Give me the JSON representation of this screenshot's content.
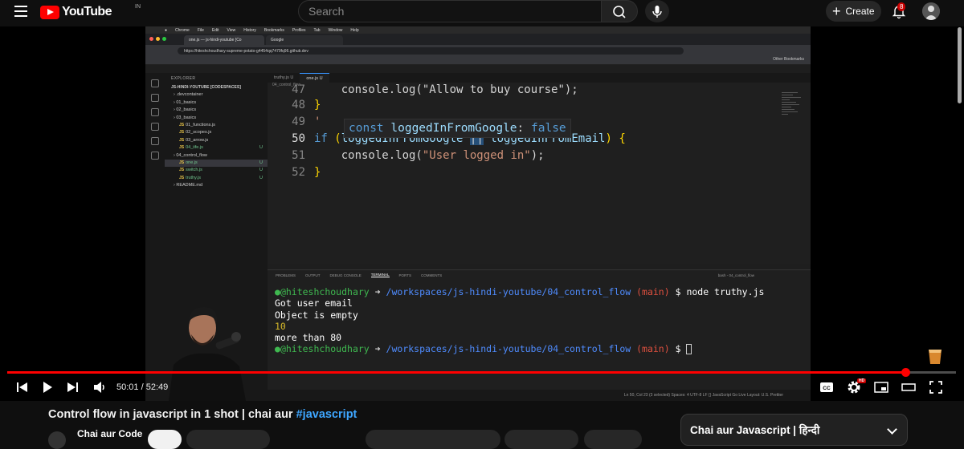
{
  "header": {
    "logo_text": "YouTube",
    "country_code": "IN",
    "search_placeholder": "Search",
    "create_label": "Create",
    "notification_count": "8"
  },
  "browser": {
    "menu": [
      "Chrome",
      "File",
      "Edit",
      "View",
      "History",
      "Bookmarks",
      "Profiles",
      "Tab",
      "Window",
      "Help"
    ],
    "tabs": [
      "one.js — js-hindi-youtube [Co",
      "Google"
    ],
    "url": "https://hiteshchoudhary-supreme-potato-g4454qq7479fq96.github.dev",
    "bookmarks_label": "Other Bookmarks"
  },
  "vscode": {
    "explorer_title": "EXPLORER",
    "workspace": "JS-HINDI-YOUTUBE [CODESPACES]",
    "tree": [
      {
        "label": ".devcontainer",
        "indent": 1,
        "js": false,
        "mark": ""
      },
      {
        "label": "01_basics",
        "indent": 1,
        "js": false,
        "mark": ""
      },
      {
        "label": "02_basics",
        "indent": 1,
        "js": false,
        "mark": ""
      },
      {
        "label": "03_basics",
        "indent": 1,
        "js": false,
        "mark": ""
      },
      {
        "label": "01_functions.js",
        "indent": 2,
        "js": true,
        "mark": ""
      },
      {
        "label": "02_scopes.js",
        "indent": 2,
        "js": true,
        "mark": ""
      },
      {
        "label": "03_arrow.js",
        "indent": 2,
        "js": true,
        "mark": ""
      },
      {
        "label": "04_iife.js",
        "indent": 2,
        "js": true,
        "mark": "U"
      },
      {
        "label": "04_control_flow",
        "indent": 1,
        "js": false,
        "mark": ""
      },
      {
        "label": "one.js",
        "indent": 2,
        "js": true,
        "mark": "U",
        "selected": true
      },
      {
        "label": "switch.js",
        "indent": 2,
        "js": true,
        "mark": "U"
      },
      {
        "label": "truthy.js",
        "indent": 2,
        "js": true,
        "mark": "U"
      },
      {
        "label": "README.md",
        "indent": 1,
        "js": false,
        "mark": ""
      }
    ],
    "editor_tabs": [
      "truthy.js U",
      "one.js U"
    ],
    "breadcrumb": "04_control_flow",
    "line_numbers": [
      "47",
      "48",
      "49",
      "50",
      "51",
      "52"
    ],
    "code": {
      "l47": "console.log(\"Allow to buy course\");",
      "l48": "}",
      "l49": "'",
      "l50_if": "if",
      "l50_a": "loggedInFromGoogle",
      "l50_op": "||",
      "l50_b": "loggedInFromEmail",
      "l51_fn": "console.log(",
      "l51_str": "\"User logged in\"",
      "l51_end": ");",
      "l52": "}"
    },
    "hint": {
      "kw": "const",
      "name": "loggedInFromGoogle",
      "type": "false"
    },
    "panel_tabs": [
      "PROBLEMS",
      "OUTPUT",
      "DEBUG CONSOLE",
      "TERMINAL",
      "PORTS",
      "COMMENTS"
    ],
    "panel_right": "bash - 04_control_flow",
    "terminal": {
      "user": "@hiteshchoudhary",
      "path": "/workspaces/js-hindi-youtube/04_control_flow",
      "branch": "(main)",
      "command": "$ node truthy.js",
      "output": [
        "Got user email",
        "Object is empty",
        "10",
        "more than 80"
      ]
    },
    "status_bar": "Ln 50, Col 23 (3 selected)   Spaces: 4   UTF-8   LF   {} JavaScript   Go Live   Layout: U.S.   Prettier"
  },
  "player": {
    "current_time": "50:01",
    "duration": "52:49",
    "progress_fraction": 0.947
  },
  "video": {
    "title_text": "Control flow in javascript in 1 shot | chai aur ",
    "title_tag": "#javascript",
    "channel_name": "Chai aur Code"
  },
  "playlist": {
    "title": "Chai aur Javascript | हिन्दी"
  },
  "colors": {
    "accent": "#ff0000",
    "link": "#3ea6ff"
  }
}
